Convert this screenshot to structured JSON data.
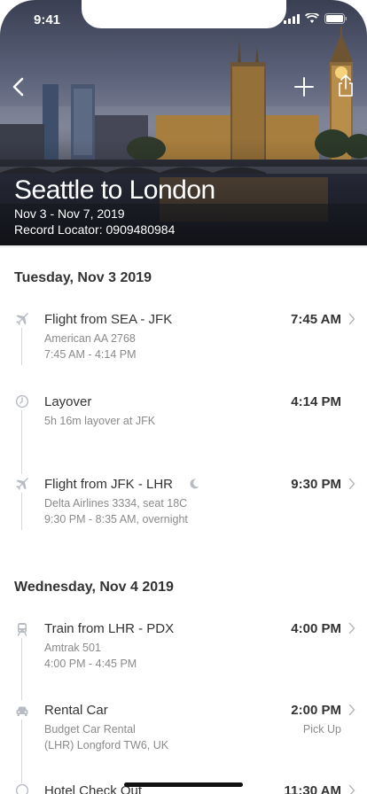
{
  "status_bar": {
    "time": "9:41"
  },
  "trip": {
    "title": "Seattle to London",
    "dates": "Nov 3 - Nov 7, 2019",
    "record_locator": "Record Locator: 0909480984"
  },
  "days": [
    {
      "header": "Tuesday, Nov 3 2019",
      "items": [
        {
          "icon": "plane-icon",
          "title": "Flight from SEA - JFK",
          "lines": [
            "American AA 2768",
            "7:45 AM - 4:14 PM"
          ],
          "time": "7:45 AM",
          "chevron": true
        },
        {
          "icon": "clock-icon",
          "title": "Layover",
          "lines": [
            "5h 16m layover at JFK"
          ],
          "time": "4:14 PM",
          "chevron": false
        },
        {
          "icon": "plane-icon",
          "title": "Flight from JFK - LHR",
          "title_badge": "moon-icon",
          "lines": [
            "Delta Airlines 3334, seat 18C",
            "9:30 PM - 8:35 AM, overnight"
          ],
          "time": "9:30 PM",
          "chevron": true
        }
      ]
    },
    {
      "header": "Wednesday, Nov 4 2019",
      "items": [
        {
          "icon": "train-icon",
          "title": "Train from LHR - PDX",
          "lines": [
            "Amtrak 501",
            "4:00 PM - 4:45 PM"
          ],
          "time": "4:00 PM",
          "chevron": true
        },
        {
          "icon": "car-icon",
          "title": "Rental Car",
          "lines": [
            "Budget Car Rental",
            "(LHR) Longford TW6, UK"
          ],
          "time": "2:00 PM",
          "time_sub": "Pick Up",
          "chevron": true
        },
        {
          "icon": "hotel-icon",
          "title": "Hotel Check Out",
          "lines": [],
          "time": "11:30 AM",
          "chevron": true
        }
      ]
    }
  ]
}
